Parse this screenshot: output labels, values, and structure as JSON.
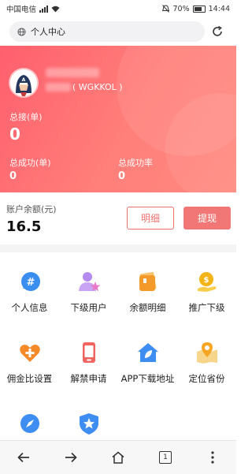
{
  "status_bar": {
    "carrier": "中国电信",
    "battery": "70%",
    "time": "14:44"
  },
  "address_bar": {
    "page_title": "个人中心"
  },
  "profile": {
    "username_suffix": "( WGKKOL )",
    "total_orders_label": "总接(单)",
    "total_orders_value": "0",
    "success_orders_label": "总成功(单)",
    "success_orders_value": "0",
    "success_rate_label": "总成功率",
    "success_rate_value": "0"
  },
  "balance": {
    "label": "账户余额(元)",
    "value": "16.5",
    "details_button": "明细",
    "withdraw_button": "提现"
  },
  "menu": [
    {
      "label": "个人信息",
      "icon": "chat-hash-icon",
      "color": "#3a8ef0"
    },
    {
      "label": "下级用户",
      "icon": "user-star-icon",
      "color": "#b58af0"
    },
    {
      "label": "余额明细",
      "icon": "wallet-cards-icon",
      "color": "#f39a2a"
    },
    {
      "label": "推广下级",
      "icon": "coin-hand-icon",
      "color": "#f2b416"
    },
    {
      "label": "佣金比设置",
      "icon": "heart-plus-icon",
      "color": "#f58a2a"
    },
    {
      "label": "解禁申请",
      "icon": "phone-icon",
      "color": "#f0645f"
    },
    {
      "label": "APP下载地址",
      "icon": "house-leaf-icon",
      "color": "#3d8df2"
    },
    {
      "label": "定位省份",
      "icon": "map-pin-icon",
      "color": "#f5b63a"
    },
    {
      "label": "",
      "icon": "compass-icon",
      "color": "#3d8df2"
    },
    {
      "label": "",
      "icon": "shield-star-icon",
      "color": "#3d8df2"
    }
  ],
  "bottom_nav": {
    "tab_count": "1"
  }
}
